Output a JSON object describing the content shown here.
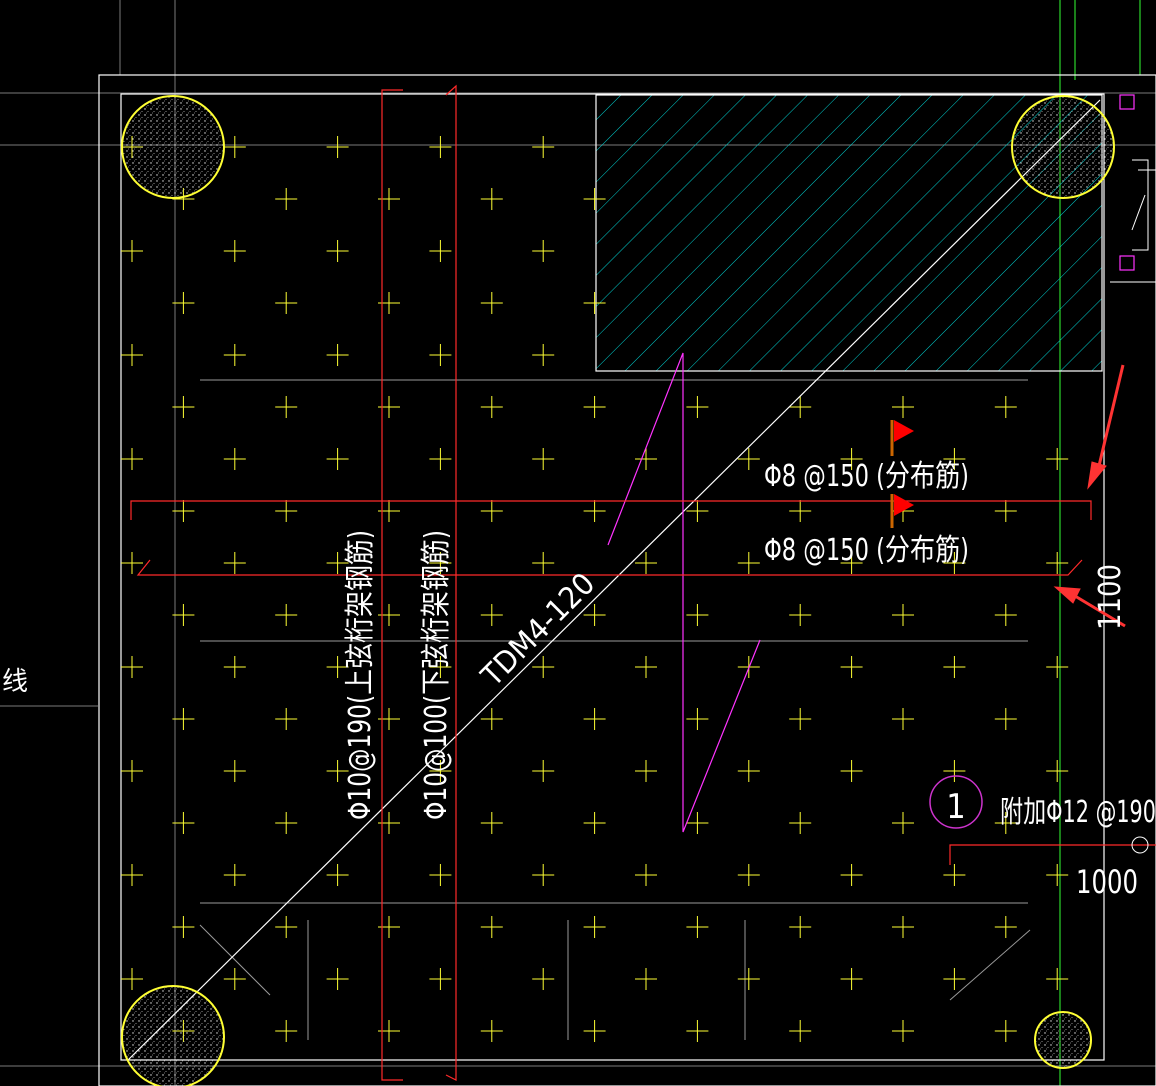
{
  "annotations": {
    "dist_rebar_upper": "Φ8 @150 (分布筋)",
    "dist_rebar_lower": "Φ8 @150 (分布筋)",
    "truss_upper": "Φ10@190(上弦桁架钢筋)",
    "truss_lower": "Φ10@100(下弦桁架钢筋)",
    "slab_label": "TDM4-120",
    "dim_right": "1100",
    "dim_bottom": "1000",
    "extra_bar": "附加Φ12 @190",
    "detail_number": "1",
    "edge_text": "线"
  },
  "colors": {
    "background": "#000000",
    "outline": "#ffffff",
    "rebar": "#ff2a2a",
    "grid_cross": "#ffff33",
    "hatch": "#00d0d0",
    "magenta": "#ff33ff",
    "green": "#33ff33",
    "pile": "#ffff33",
    "guide": "#a6a6a6"
  },
  "icons": [
    "flag-icon",
    "arrow-icon",
    "pile-circle-icon"
  ]
}
